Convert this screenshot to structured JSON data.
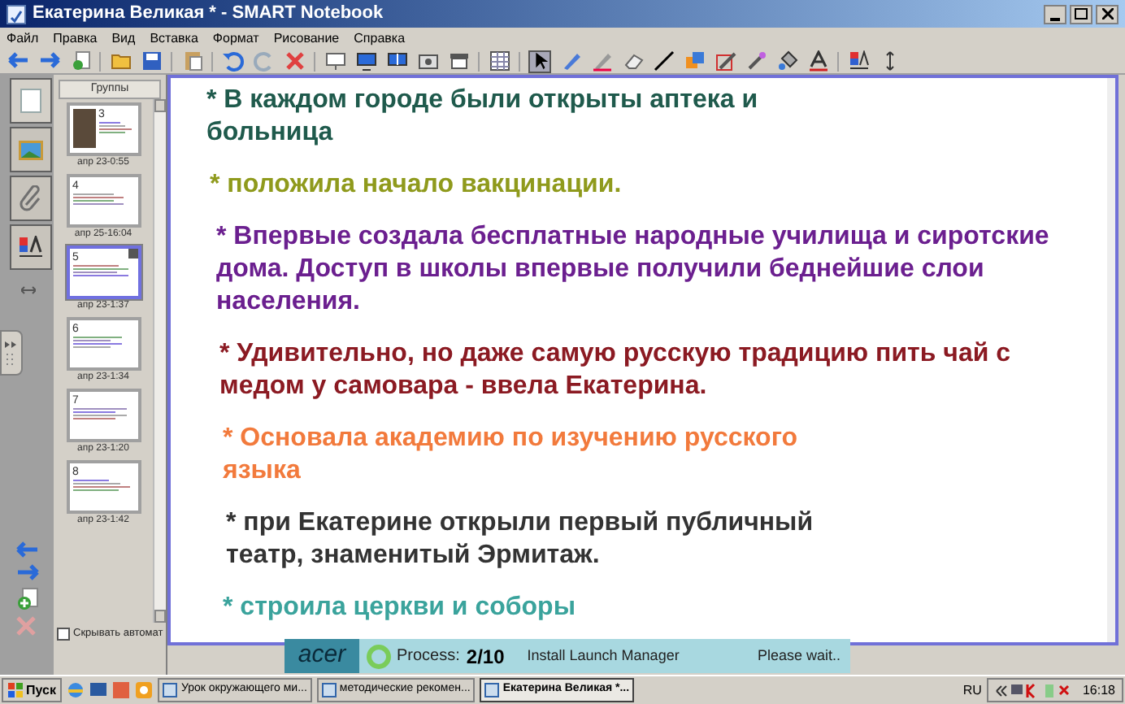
{
  "window": {
    "title": "Екатерина Великая * - SMART Notebook"
  },
  "menu": [
    "Файл",
    "Правка",
    "Вид",
    "Вставка",
    "Формат",
    "Рисование",
    "Справка"
  ],
  "sorter": {
    "groups_button": "Группы",
    "hide_checkbox": {
      "label": "Скрывать автомат",
      "checked": false
    },
    "pages": [
      {
        "number": "3",
        "date": "апр 23-0:55",
        "selected": false,
        "kind": "photo"
      },
      {
        "number": "4",
        "date": "апр 25-16:04",
        "selected": false,
        "kind": "text"
      },
      {
        "number": "5",
        "date": "апр 23-1:37",
        "selected": true,
        "kind": "text"
      },
      {
        "number": "6",
        "date": "апр 23-1:34",
        "selected": false,
        "kind": "text"
      },
      {
        "number": "7",
        "date": "апр 23-1:20",
        "selected": false,
        "kind": "text"
      },
      {
        "number": "8",
        "date": "апр 23-1:42",
        "selected": false,
        "kind": "text"
      }
    ]
  },
  "slide": {
    "items": [
      {
        "text": "* В каждом городе были открыты аптека и больница",
        "color": "#1f5a4c"
      },
      {
        "text": "* положила начало вакцинации.",
        "color": "#8f9a1c"
      },
      {
        "text": "* Впервые создала бесплатные народные училища и сиротские дома. Доступ в школы впервые получили беднейшие слои населения.",
        "color": "#6b1f8f"
      },
      {
        "text": "* Удивительно, но даже самую русскую традицию пить чай с медом у самовара - ввела Екатерина.",
        "color": "#8b1a22"
      },
      {
        "text": "* Основала академию по изучению русского языка",
        "color": "#f27a3c"
      },
      {
        "text": "* при Екатерине открыли первый публичный театр, знаменитый Эрмитаж.",
        "color": "#333333"
      },
      {
        "text": "* строила церкви и соборы",
        "color": "#3aa39c"
      }
    ]
  },
  "installer": {
    "brand": "acer",
    "process_label": "Process:",
    "process_value": "2/10",
    "task": "Install Launch Manager",
    "status": "Please wait.."
  },
  "taskbar": {
    "start": "Пуск",
    "tasks": [
      {
        "label": "Урок окружающего ми...",
        "selected": false
      },
      {
        "label": "методические рекомен...",
        "selected": false
      },
      {
        "label": "Екатерина Великая *...",
        "selected": true
      }
    ],
    "language": "RU",
    "clock": "16:18"
  }
}
